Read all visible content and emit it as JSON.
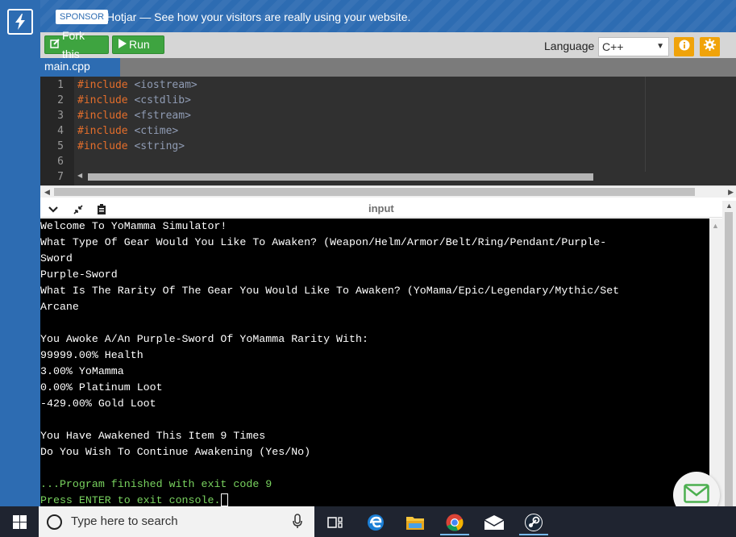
{
  "sponsor": {
    "badge": "SPONSOR",
    "text": "Hotjar — See how your visitors are really using your website."
  },
  "toolbar": {
    "fork_label": "Fork this",
    "run_label": "Run",
    "language_label": "Language",
    "language_value": "C++"
  },
  "tabs": [
    {
      "label": "main.cpp"
    }
  ],
  "editor": {
    "lines": [
      {
        "num": "1",
        "kw": "#include",
        "rest": " <iostream>"
      },
      {
        "num": "2",
        "kw": "#include",
        "rest": " <cstdlib>"
      },
      {
        "num": "3",
        "kw": "#include",
        "rest": " <fstream>"
      },
      {
        "num": "4",
        "kw": "#include",
        "rest": " <ctime>"
      },
      {
        "num": "5",
        "kw": "#include",
        "rest": " <string>"
      },
      {
        "num": "6",
        "kw": "",
        "rest": ""
      },
      {
        "num": "7",
        "kw": "",
        "rest": ""
      }
    ]
  },
  "console": {
    "title": "input",
    "lines": [
      "Welcome To YoMamma Simulator!",
      "What Type Of Gear Would You Like To Awaken? (Weapon/Helm/Armor/Belt/Ring/Pendant/Purple-",
      "Sword",
      "Purple-Sword",
      "What Is The Rarity Of The Gear You Would Like To Awaken? (YoMama/Epic/Legendary/Mythic/Set",
      "Arcane",
      "",
      "You Awoke A/An Purple-Sword Of YoMamma Rarity With:",
      "99999.00% Health",
      "3.00% YoMamma",
      "0.00% Platinum Loot",
      "-429.00% Gold Loot",
      "",
      "You Have Awakened This Item 9 Times",
      "Do You Wish To Continue Awakening (Yes/No)",
      "",
      "...Program finished with exit code 9",
      "Press ENTER to exit console."
    ]
  },
  "taskbar": {
    "search_placeholder": "Type here to search"
  }
}
